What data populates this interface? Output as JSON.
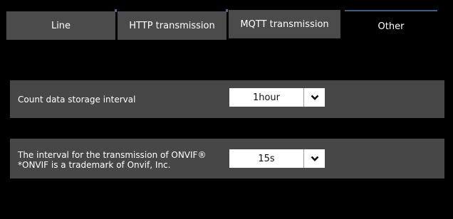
{
  "tabs": [
    {
      "label": "Line",
      "state": "inactive"
    },
    {
      "label": "HTTP transmission",
      "state": "inactive"
    },
    {
      "label": "MQTT transmission",
      "state": "inactive"
    },
    {
      "label": "Other",
      "state": "active"
    }
  ],
  "settings": {
    "storage_interval": {
      "label": "Count data storage interval",
      "value": "1hour"
    },
    "onvif_interval": {
      "label_line1": "The interval for the transmission of ONVIF®",
      "label_line2": "*ONVIF is a trademark of Onvif, Inc.",
      "value": "15s"
    }
  },
  "colors": {
    "background": "#000000",
    "tab_inactive": "#4b4b4b",
    "row_background": "#474747",
    "accent": "#3a6fb0"
  },
  "icons": {
    "dropdown": "chevron-down-icon"
  }
}
